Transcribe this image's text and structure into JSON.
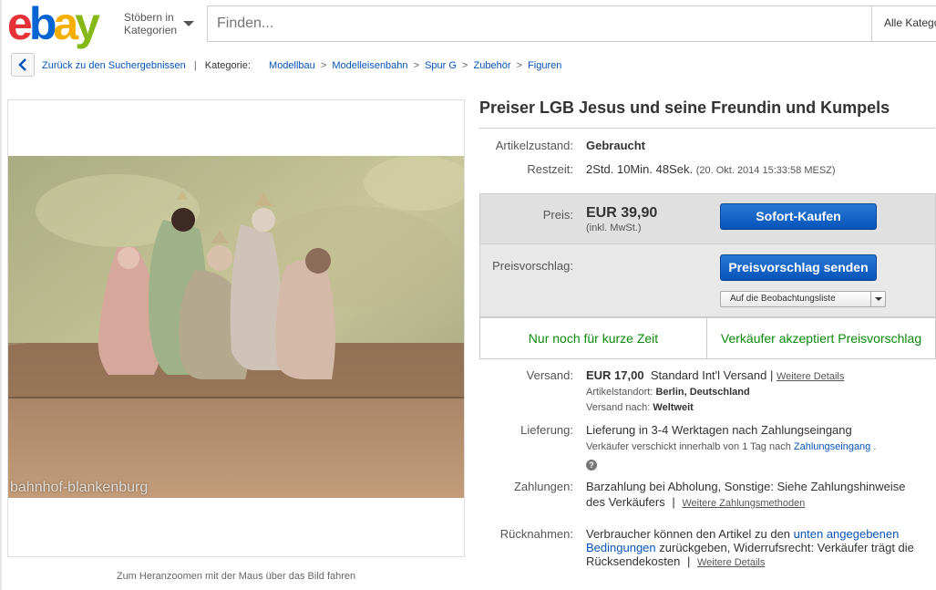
{
  "header": {
    "logo_text": "ebay",
    "browse_line1": "Stöbern in",
    "browse_line2": "Kategorien",
    "search_placeholder": "Finden...",
    "category_select": "Alle Kategorien"
  },
  "breadcrumb": {
    "back_label": "Zurück zu den Suchergebnissen",
    "category_label": "Kategorie:",
    "items": [
      "Modellbau",
      "Modelleisenbahn",
      "Spur G",
      "Zubehör",
      "Figuren"
    ],
    "separator": ">"
  },
  "image": {
    "watermark": "bahnhof-blankenburg",
    "zoom_hint": "Zum Heranzoomen mit der Maus über das Bild fahren"
  },
  "item": {
    "title": "Preiser LGB Jesus und seine Freundin und Kumpels",
    "condition_label": "Artikelzustand:",
    "condition_value": "Gebraucht",
    "time_label": "Restzeit:",
    "time_value": "2Std. 10Min. 48Sek.",
    "end_date": "(20. Okt. 2014  15:33:58 MESZ)",
    "price_label": "Preis:",
    "price_value": "EUR 39,90",
    "price_note": "(inkl. MwSt.)",
    "buy_button": "Sofort-Kaufen",
    "offer_label": "Preisvorschlag:",
    "offer_button": "Preisvorschlag senden",
    "watch_button": "Auf die Beobachtungsliste",
    "promo_left": "Nur noch für kurze Zeit",
    "promo_right": "Verkäufer akzeptiert Preisvorschlag"
  },
  "shipping": {
    "label": "Versand:",
    "cost": "EUR 17,00",
    "service": "Standard Int'l Versand",
    "pipe": "|",
    "details_link": "Weitere Details",
    "location_label": "Artikelstandort:",
    "location_value": "Berlin, Deutschland",
    "ships_to_label": "Versand nach:",
    "ships_to_value": "Weltweit"
  },
  "delivery": {
    "label": "Lieferung:",
    "value": "Lieferung in 3-4 Werktagen nach Zahlungseingang",
    "note_prefix": "Verkäufer verschickt innerhalb von 1 Tag nach",
    "note_link": "Zahlungseingang",
    "note_suffix": ".",
    "help_glyph": "?"
  },
  "payment": {
    "label": "Zahlungen:",
    "line1": "Barzahlung bei Abholung,  Sonstige: Siehe Zahlungshinweise",
    "line2": "des Verkäufers",
    "pipe": "|",
    "link": "Weitere Zahlungsmethoden"
  },
  "returns": {
    "label": "Rücknahmen:",
    "line1_prefix": "Verbraucher können den Artikel zu den",
    "line1_link": "unten angegebenen",
    "line2_link": "Bedingungen",
    "line2_suffix": "zurückgeben, Widerrufsrecht: Verkäufer trägt die",
    "line3": "Rücksendekosten",
    "pipe": "|",
    "details_link": "Weitere Details"
  },
  "colors": {
    "link": "#0654ba",
    "buy_button": "#0654ba",
    "promo_green": "#0a8a0a",
    "logo_e": "#e53238",
    "logo_b": "#0064d2",
    "logo_a": "#f5af02",
    "logo_y": "#86b817"
  }
}
